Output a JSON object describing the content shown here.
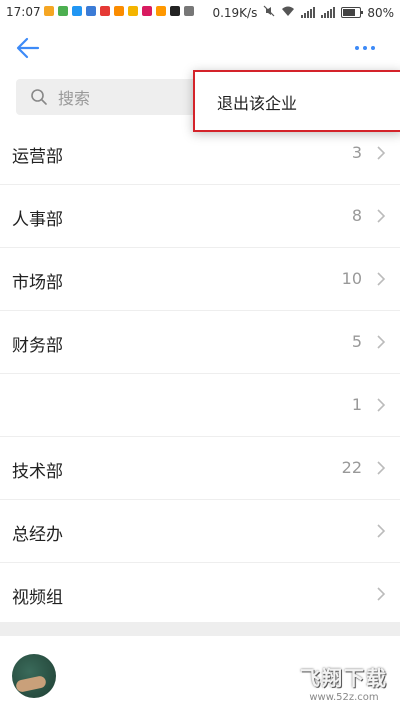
{
  "status_bar": {
    "time": "17:07",
    "network_speed": "0.19K/s",
    "battery": "80%",
    "app_icon_colors": [
      "#f5a623",
      "#4caf50",
      "#2196f3",
      "#3b7bd6",
      "#e53935",
      "#fb8c00",
      "#f4b400",
      "#d81b60",
      "#ff9800",
      "#222222",
      "#777777"
    ]
  },
  "header": {
    "back_icon": "arrow-left-icon",
    "more_icon": "more-horizontal-icon",
    "accent_color": "#3d8af7"
  },
  "search": {
    "placeholder": "搜索",
    "value": ""
  },
  "departments": [
    {
      "name": "运营部",
      "count": "3"
    },
    {
      "name": "人事部",
      "count": "8"
    },
    {
      "name": "市场部",
      "count": "10"
    },
    {
      "name": "财务部",
      "count": "5"
    },
    {
      "name": "",
      "count": "1"
    },
    {
      "name": "技术部",
      "count": "22"
    },
    {
      "name": "总经办",
      "count": ""
    },
    {
      "name": "视频组",
      "count": ""
    }
  ],
  "popup_menu": {
    "items": [
      "退出该企业"
    ],
    "highlight_color": "#d4232a"
  },
  "watermark": {
    "logo_text": "飞翔下载",
    "url": "www.52z.com"
  }
}
